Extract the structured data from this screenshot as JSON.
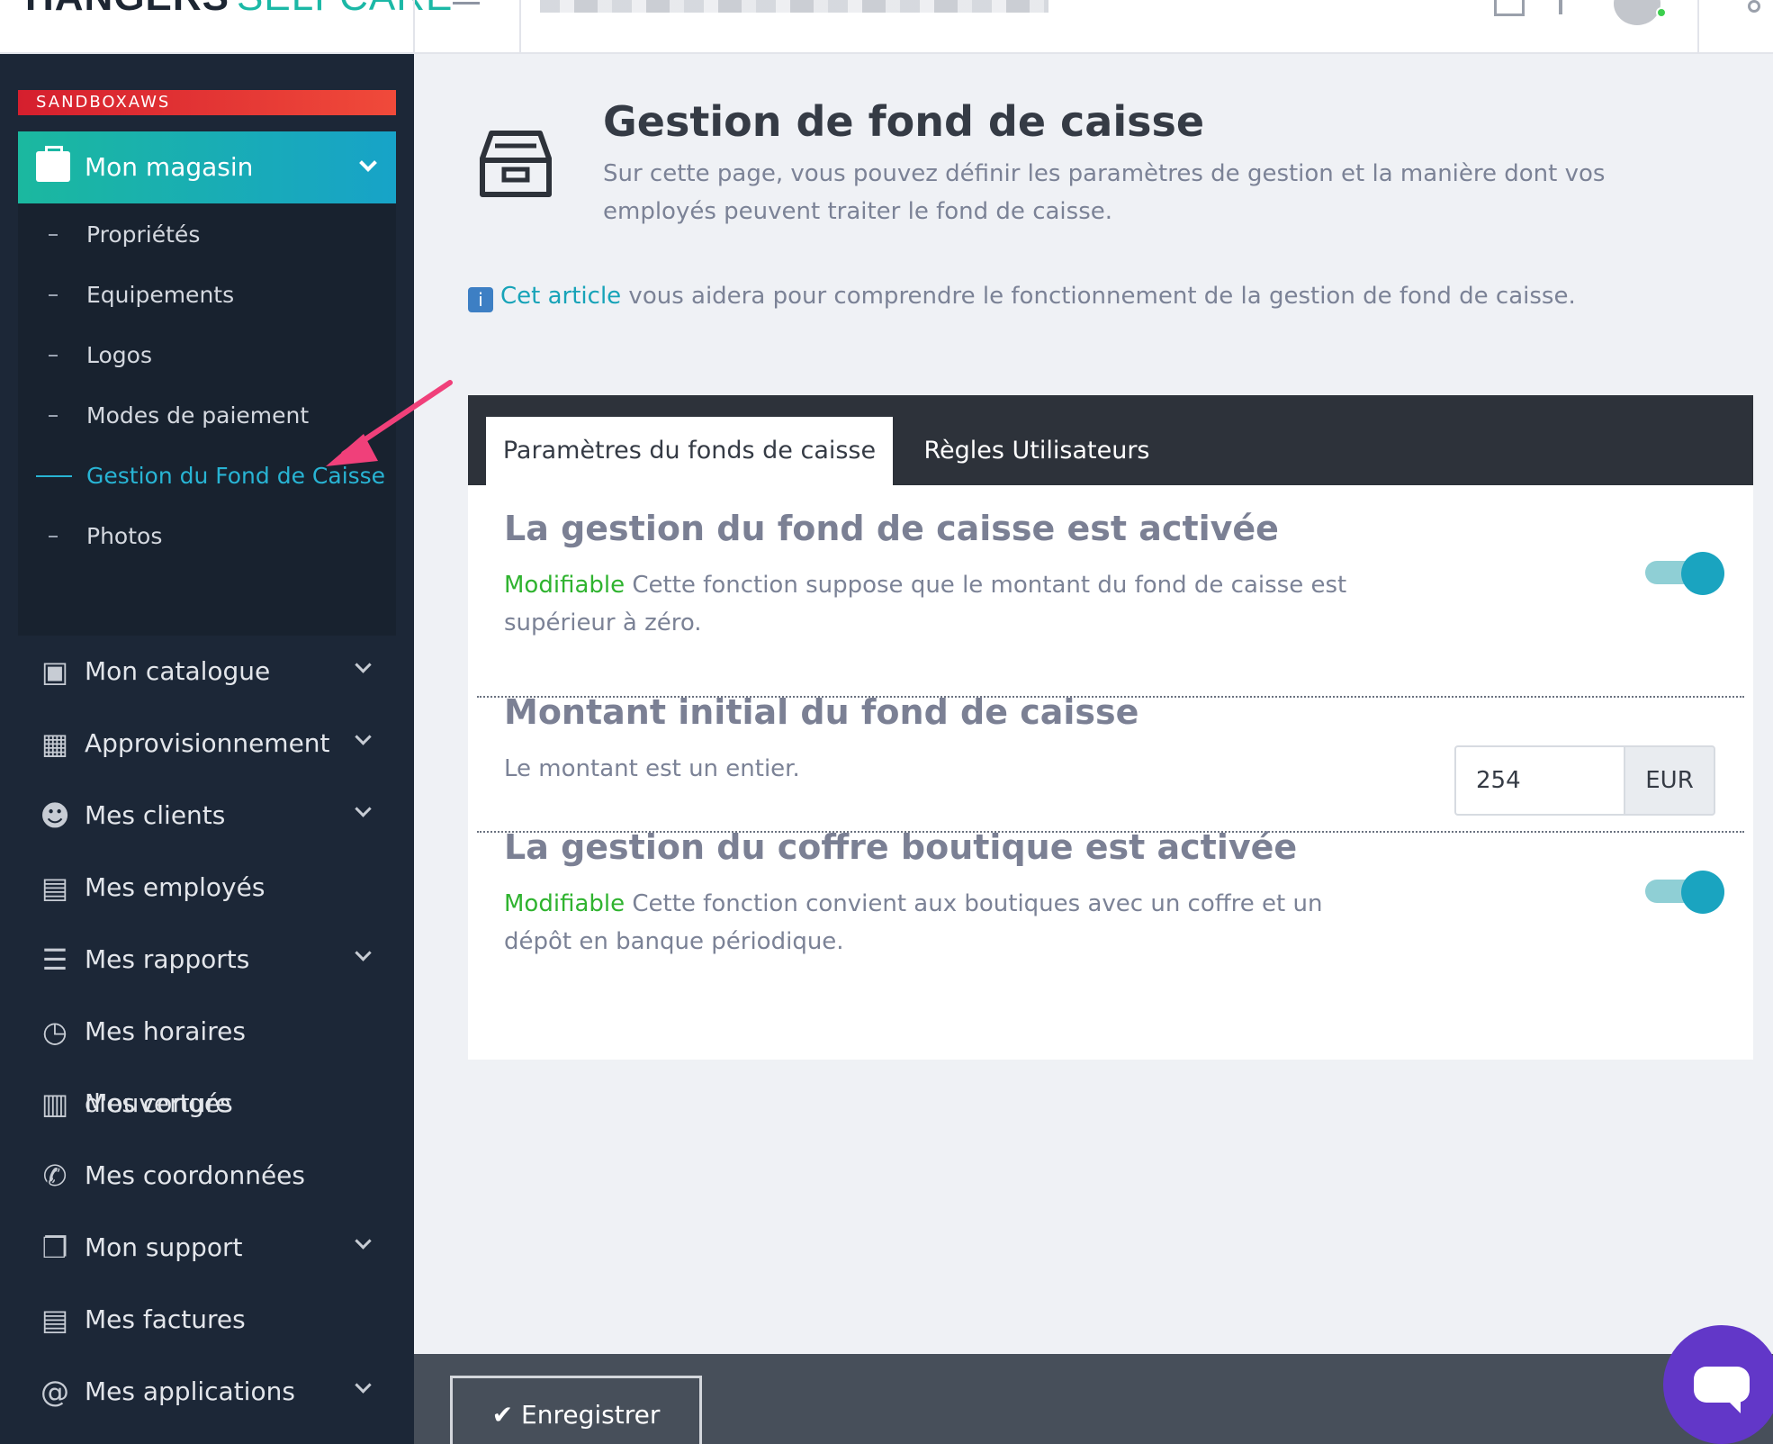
{
  "brand": {
    "name_part1": "HANGERS",
    "name_part2": "SELFCARE"
  },
  "sidebar": {
    "environment_badge": "SANDBOXAWS",
    "active_menu": {
      "label": "Mon magasin",
      "icon": "store-icon"
    },
    "submenu": [
      {
        "label": "Propriétés"
      },
      {
        "label": "Equipements"
      },
      {
        "label": "Logos"
      },
      {
        "label": "Modes de paiement"
      },
      {
        "label": "Gestion du Fond de Caisse",
        "active": true
      },
      {
        "label": "Photos"
      }
    ],
    "menu": [
      {
        "label": "Mon catalogue",
        "icon": "box-icon",
        "has_dropdown": true
      },
      {
        "label": "Approvisionnement",
        "icon": "boxes-icon",
        "has_dropdown": true
      },
      {
        "label": "Mes clients",
        "icon": "users-icon",
        "has_dropdown": true
      },
      {
        "label": "Mes employés",
        "icon": "book-icon",
        "has_dropdown": false
      },
      {
        "label": "Mes rapports",
        "icon": "list-icon",
        "has_dropdown": true
      },
      {
        "label": "Mes horaires d'ouverture",
        "icon": "clock-icon",
        "has_dropdown": false
      },
      {
        "label": "Mes congés",
        "icon": "calendar-icon",
        "has_dropdown": false
      },
      {
        "label": "Mes coordonnées",
        "icon": "phone-icon",
        "has_dropdown": false
      },
      {
        "label": "Mon support",
        "icon": "chat-icon",
        "has_dropdown": true
      },
      {
        "label": "Mes factures",
        "icon": "invoice-icon",
        "has_dropdown": false
      },
      {
        "label": "Mes applications",
        "icon": "at-icon",
        "has_dropdown": true
      }
    ]
  },
  "page": {
    "title": "Gestion de fond de caisse",
    "subtitle": "Sur cette page, vous pouvez définir les paramètres de gestion et la manière dont vos employés peuvent traiter le fond de caisse.",
    "info_link": "Cet article",
    "info_text": " vous aidera pour comprendre le fonctionnement de la gestion de fond de caisse."
  },
  "tabs": [
    {
      "label": "Paramètres du fonds de caisse",
      "active": true
    },
    {
      "label": "Règles Utilisateurs",
      "active": false
    }
  ],
  "settings": {
    "cash_management": {
      "title": "La gestion du fond de caisse est activée",
      "badge": "Modifiable",
      "description": " Cette fonction suppose que le montant du fond de caisse est supérieur à zéro.",
      "enabled": true
    },
    "initial_amount": {
      "title": "Montant initial du fond de caisse",
      "description": "Le montant est un entier.",
      "value": "254",
      "unit": "EUR"
    },
    "safe_management": {
      "title": "La gestion du coffre boutique est activée",
      "badge": "Modifiable",
      "description": " Cette fonction convient aux boutiques avec un coffre et un dépôt en banque périodique.",
      "enabled": true
    }
  },
  "footer": {
    "save_label": "Enregistrer"
  },
  "colors": {
    "accent": "#1aa4c0",
    "sidebar_bg": "#1c2737",
    "badge_red": "#e23a35",
    "chat": "#6237c8",
    "modifiable_green": "#2fb32f"
  }
}
